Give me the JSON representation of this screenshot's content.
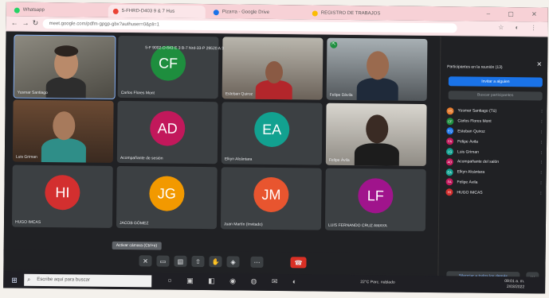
{
  "browser": {
    "tabs": [
      {
        "label": "Whatsapp",
        "color": "#25d366"
      },
      {
        "label": "5-FHRD-D403 9 & 7 Hus",
        "color": "#ea4335",
        "active": true
      },
      {
        "label": "Pizarra - Google Drive",
        "color": "#1a73e8"
      },
      {
        "label": "REGISTRO DE TRABAJOS",
        "color": "#fbbc04"
      }
    ],
    "address": "meet.google.com/pdfm-gpgp-gbx?authuser=0&pli=1"
  },
  "meeting": {
    "code_bar": "5-F 9002-D-643 E 3 B-7 Nrd-33-P 29520 A 3",
    "tiles": [
      {
        "name": "Yusmar Santiago",
        "type": "camera"
      },
      {
        "name": "Carlos Flores Mont",
        "initials": "CF",
        "color": "#1e8e3e"
      },
      {
        "name": "Esteban Quiroz",
        "type": "camera"
      },
      {
        "name": "Felipe Dávila",
        "type": "camera"
      },
      {
        "name": "Luis Griman",
        "type": "camera"
      },
      {
        "name": "Acompañante de sesión",
        "initials": "AD",
        "color": "#c2185b"
      },
      {
        "name": "Elkyn Alcántara",
        "initials": "EA",
        "color": "#12a190"
      },
      {
        "name": "Felipe Ávila",
        "type": "camera"
      },
      {
        "name": "HUGO IMCAS",
        "initials": "HI",
        "color": "#d32f2f"
      },
      {
        "name": "JACOB GÓMEZ",
        "initials": "JG",
        "color": "#f29900"
      },
      {
        "name": "Juan Martín (Invitado)",
        "initials": "JM",
        "color": "#e8552f"
      },
      {
        "name": "LUIS FERNANDO CRUZ AMAYA",
        "initials": "LF",
        "color": "#a0148c"
      }
    ],
    "tooltip": "Activar cámara (Ctrl+e)",
    "controls": [
      "mic-off",
      "camera-off",
      "captions",
      "present",
      "raise-hand",
      "activities",
      "more",
      "leave"
    ]
  },
  "panel": {
    "title": "Participantes en la reunión (13)",
    "invite": "Invitar a alguien",
    "search": "Buscar participantes",
    "participants": [
      {
        "name": "Yusmar Santiago (Tú)",
        "initials": "YS",
        "color": "#e67c2e"
      },
      {
        "name": "Carlos Flores Mont",
        "initials": "CF",
        "color": "#1e8e3e"
      },
      {
        "name": "Esteban Quiroz",
        "initials": "EQ",
        "color": "#1a73e8"
      },
      {
        "name": "Felipe Ávila",
        "initials": "FA",
        "color": "#c2185b"
      },
      {
        "name": "Luis Griman",
        "initials": "LG",
        "color": "#12a190"
      },
      {
        "name": "Acompañante del salón",
        "initials": "AD",
        "color": "#c2185b"
      },
      {
        "name": "Elkyn Alcántara",
        "initials": "EA",
        "color": "#12a190"
      },
      {
        "name": "Felipe Ávila",
        "initials": "FA",
        "color": "#c2185b"
      },
      {
        "name": "HUGO IMCAS",
        "initials": "HI",
        "color": "#d32f2f"
      }
    ],
    "mute_all": "Silenciar a todos los demás"
  },
  "taskbar": {
    "search": "Escribe aquí para buscar",
    "tray": "22°C  Parc. nublado",
    "time": "09:01 a. m.",
    "date": "2/03/2022"
  }
}
